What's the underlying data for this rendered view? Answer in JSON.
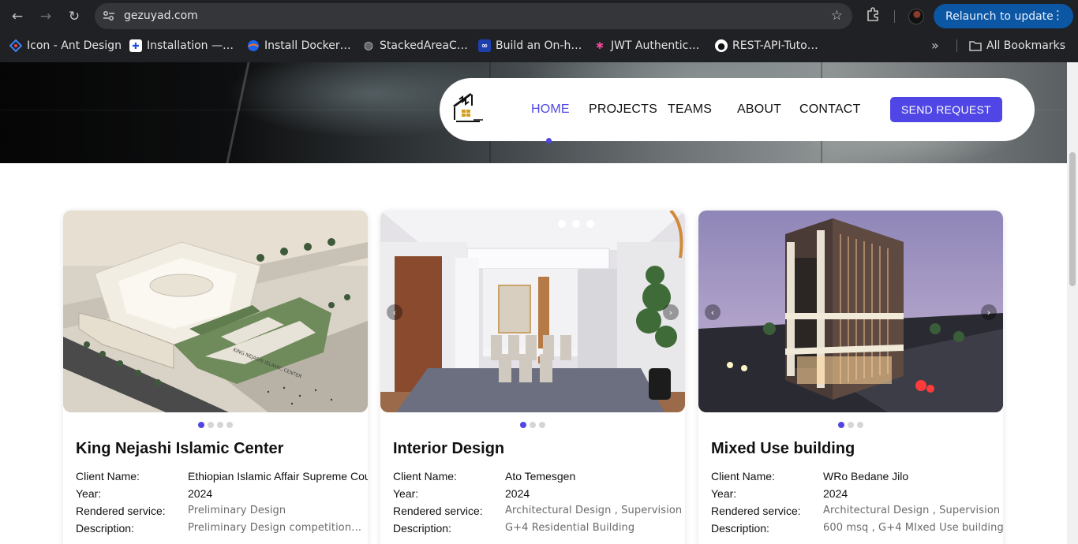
{
  "browser": {
    "url": "gezuyad.com",
    "relaunch_label": "Relaunch to update",
    "bookmarks": [
      {
        "label": "Icon - Ant Design",
        "icon": "ant-design-icon"
      },
      {
        "label": "Installation —…",
        "icon": "docs-icon"
      },
      {
        "label": "Install Docker…",
        "icon": "docker-icon"
      },
      {
        "label": "StackedAreaC…",
        "icon": "globe-icon"
      },
      {
        "label": "Build an On-h…",
        "icon": "infinity-icon"
      },
      {
        "label": "JWT Authentic…",
        "icon": "jwt-icon"
      },
      {
        "label": "REST-API-Tuto…",
        "icon": "github-icon"
      }
    ],
    "all_bookmarks_label": "All Bookmarks"
  },
  "site": {
    "nav": {
      "home": "HOME",
      "projects": "PROJECTS",
      "teams": "TEAMS",
      "about": "ABOUT",
      "contact": "CONTACT",
      "cta": "SEND REQUEST"
    },
    "accent_color": "#4f46e5"
  },
  "projects": [
    {
      "title": "King Nejashi Islamic Center",
      "client_label": "Client Name:",
      "client": "Ethiopian Islamic Affair Supreme Cou",
      "year_label": "Year:",
      "year": "2024",
      "service_label": "Rendered service:",
      "service": "Preliminary Design",
      "desc_label": "Description:",
      "desc": "Preliminary Design competition…",
      "slides": 4,
      "active_slide": 1
    },
    {
      "title": "Interior Design",
      "client_label": "Client Name:",
      "client": "Ato Temesgen",
      "year_label": "Year:",
      "year": "2024",
      "service_label": "Rendered service:",
      "service": "Architectural Design , Supervision",
      "desc_label": "Description:",
      "desc": "G+4 Residential Building",
      "slides": 3,
      "active_slide": 1
    },
    {
      "title": "Mixed Use building",
      "client_label": "Client Name:",
      "client": "WRo Bedane Jilo",
      "year_label": "Year:",
      "year": "2024",
      "service_label": "Rendered service:",
      "service": "Architectural Design , Supervision",
      "desc_label": "Description:",
      "desc": "600 msq , G+4 MIxed Use building",
      "slides": 3,
      "active_slide": 1
    }
  ]
}
